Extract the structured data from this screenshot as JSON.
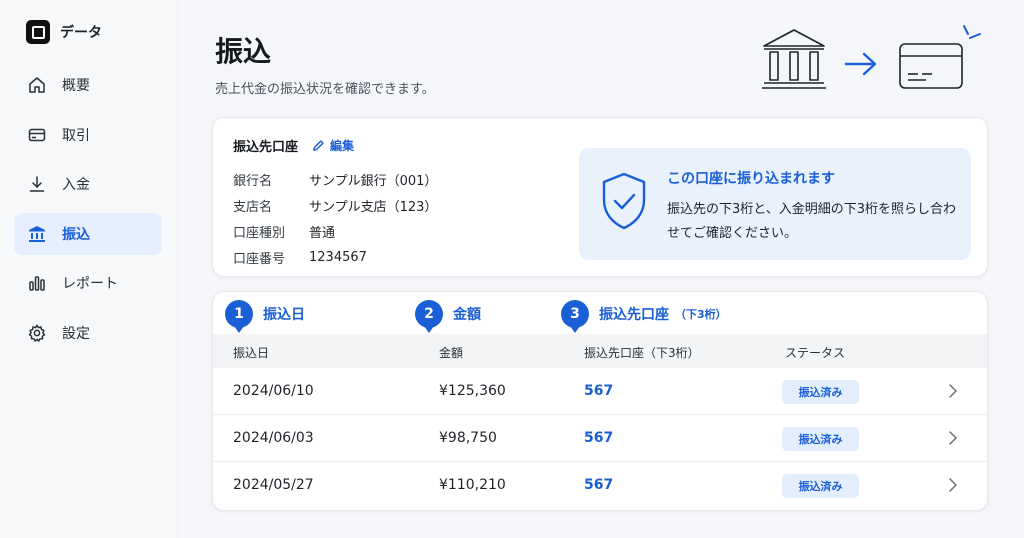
{
  "brand": {
    "name": "データ"
  },
  "sidebar": {
    "items": [
      {
        "label": "概要",
        "icon": "home-icon",
        "active": false
      },
      {
        "label": "取引",
        "icon": "card-icon",
        "active": false
      },
      {
        "label": "入金",
        "icon": "download-icon",
        "active": false
      },
      {
        "label": "振込",
        "icon": "bank-icon",
        "active": true
      },
      {
        "label": "レポート",
        "icon": "bar-chart-icon",
        "active": false
      },
      {
        "label": "設定",
        "icon": "gear-icon",
        "active": false
      }
    ]
  },
  "header": {
    "title": "振込",
    "subtitle": "売上代金の振込状況を確認できます。"
  },
  "account": {
    "title": "振込先口座",
    "edit_label": "編集",
    "fields": [
      {
        "label": "銀行名",
        "value": "サンプル銀行（001）"
      },
      {
        "label": "支店名",
        "value": "サンプル支店（123）"
      },
      {
        "label": "口座種別",
        "value": "普通"
      },
      {
        "label": "口座番号",
        "value": "1234567"
      }
    ],
    "notice": {
      "title": "この口座に振り込まれます",
      "body": "振込先の下3桁と、入金明細の下3桁を照らし合わせてご確認ください。"
    }
  },
  "steps": [
    {
      "num": "1",
      "label": "振込日",
      "note": ""
    },
    {
      "num": "2",
      "label": "金額",
      "note": ""
    },
    {
      "num": "3",
      "label": "振込先口座",
      "note": "（下3桁）"
    }
  ],
  "table": {
    "columns": [
      "振込日",
      "金額",
      "振込先口座（下3桁）",
      "ステータス"
    ],
    "rows": [
      {
        "date": "2024/06/10",
        "amount": "¥125,360",
        "account": "567",
        "status": "振込済み"
      },
      {
        "date": "2024/06/03",
        "amount": "¥98,750",
        "account": "567",
        "status": "振込済み"
      },
      {
        "date": "2024/05/27",
        "amount": "¥110,210",
        "account": "567",
        "status": "振込済み"
      }
    ]
  },
  "colors": {
    "accent": "#1a5fd6",
    "active_bg": "#e6efff",
    "notice_bg": "#e8f1fc",
    "badge_bg": "#e3eefc"
  }
}
